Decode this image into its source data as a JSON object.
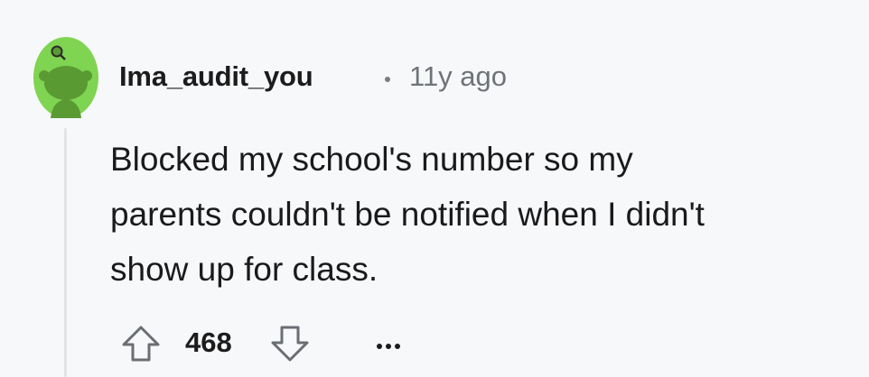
{
  "comment": {
    "author": "Ima_audit_you",
    "separator": "•",
    "age": "11y ago",
    "body_lines": [
      "Blocked my school's number so my",
      "parents couldn't be notified when I didn't",
      "show up for class."
    ],
    "score": "468",
    "icons": {
      "avatar": "reddit-snoo-avatar-icon",
      "upvote": "arrow-up-icon",
      "downvote": "arrow-down-icon",
      "more": "more-options-icon"
    },
    "colors": {
      "avatar_background": "#7fd452",
      "avatar_figure": "#5a9a33",
      "thread_line": "#e2e4e7",
      "timestamp": "#6f7378",
      "vote_arrow": "#6a6e73"
    }
  }
}
